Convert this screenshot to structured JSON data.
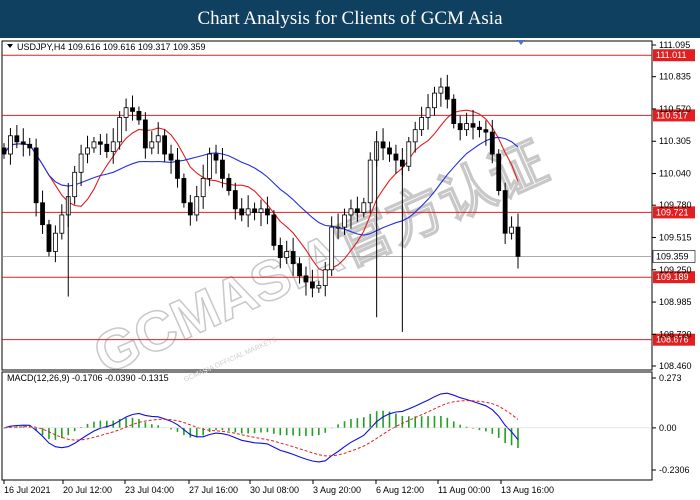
{
  "title": "Chart Analysis for Clients of GCM Asia",
  "watermark": {
    "text": "GCMASIA官方认证",
    "subtext": "GCMASIA OFFICIAL MARKETS"
  },
  "chart_data": [
    {
      "type": "candlestick",
      "header": "USDJPY,H4  109.616 109.616 109.317 109.359",
      "symbol": "USDJPY,H4",
      "ohlc_header": [
        109.616,
        109.616,
        109.317,
        109.359
      ],
      "ylim": [
        108.46,
        111.095
      ],
      "y_ticks": [
        "111.095",
        "110.835",
        "110.570",
        "110.305",
        "110.040",
        "109.780",
        "109.515",
        "109.250",
        "108.985",
        "108.720",
        "108.460"
      ],
      "x_tick_labels": [
        "16 Jul 2021",
        "20 Jul 12:00",
        "23 Jul 04:00",
        "27 Jul 16:00",
        "30 Jul 08:00",
        "3 Aug 20:00",
        "6 Aug 12:00",
        "11 Aug 00:00",
        "13 Aug 16:00"
      ],
      "levels": [
        {
          "value": 111.011,
          "label": "111.011",
          "color": "#e02020"
        },
        {
          "value": 110.517,
          "label": "110.517",
          "color": "#e02020"
        },
        {
          "value": 109.721,
          "label": "109.721",
          "color": "#e02020"
        },
        {
          "value": 109.189,
          "label": "109.189",
          "color": "#e02020"
        },
        {
          "value": 108.676,
          "label": "108.676",
          "color": "#e02020"
        }
      ],
      "current_price": {
        "value": 109.359,
        "label": "109.359"
      },
      "moving_averages": [
        {
          "color": "#e02020"
        },
        {
          "color": "#2030e0"
        }
      ],
      "close_series": [
        110.2,
        110.35,
        110.3,
        110.28,
        110.25,
        109.8,
        109.62,
        109.4,
        109.55,
        109.7,
        109.85,
        110.05,
        110.2,
        110.25,
        110.3,
        110.28,
        110.22,
        110.3,
        110.5,
        110.58,
        110.55,
        110.48,
        110.25,
        110.3,
        110.35,
        110.2,
        110.15,
        110.0,
        109.8,
        109.7,
        109.85,
        110.0,
        110.2,
        110.15,
        110.0,
        109.9,
        109.75,
        109.7,
        109.75,
        109.72,
        109.75,
        109.7,
        109.45,
        109.35,
        109.4,
        109.3,
        109.2,
        109.15,
        109.1,
        109.12,
        109.25,
        109.6,
        109.6,
        109.7,
        109.75,
        109.72,
        109.8,
        110.15,
        110.3,
        110.25,
        110.2,
        110.15,
        110.1,
        110.3,
        110.4,
        110.5,
        110.58,
        110.7,
        110.75,
        110.65,
        110.45,
        110.4,
        110.45,
        110.42,
        110.4,
        110.38,
        110.2,
        109.9,
        109.55,
        109.6,
        109.36
      ],
      "candles_note": "H4 USDJPY candles, 16 Jul - 13 Aug 2021",
      "macd": {
        "label": "MACD(12,26,9) -0.1706 -0.0390 -0.1315",
        "ylim": [
          -0.2306,
          0.273
        ],
        "y_ticks": [
          "0.273",
          "0.00",
          "-0.2306"
        ],
        "macd_line_color": "#1010e0",
        "signal_line_color": "#e02020",
        "histogram_color": "#20a020",
        "values": [
          -0.1706,
          -0.039,
          -0.1315
        ]
      }
    }
  ]
}
